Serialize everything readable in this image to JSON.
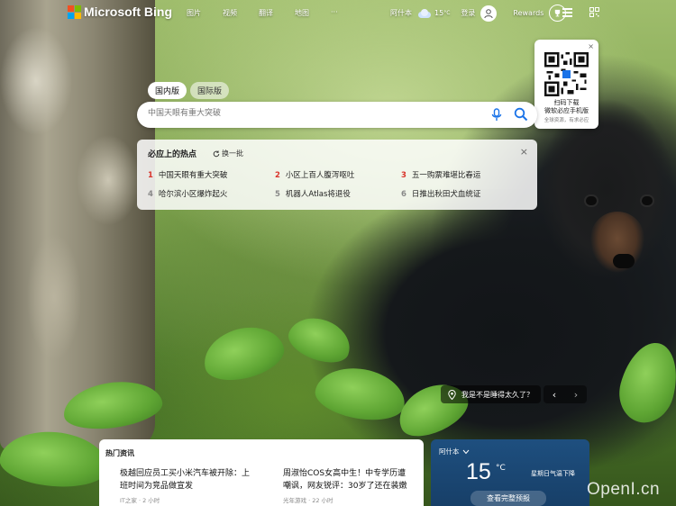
{
  "brand": {
    "name": "Microsoft Bing"
  },
  "nav": {
    "items": [
      "图片",
      "视频",
      "翻译",
      "地图",
      "···"
    ]
  },
  "topright": {
    "city": "阿什本",
    "temp": "15",
    "temp_unit": "°C",
    "login": "登录",
    "rewards": "Rewards"
  },
  "qr_popup": {
    "close": "×",
    "line1": "扫码下载",
    "line2": "微软必应手机版",
    "line3": "全球资源，有求必应"
  },
  "search": {
    "tabs": [
      "国内版",
      "国际版"
    ],
    "placeholder": "中国天眼有重大突破"
  },
  "hot": {
    "title": "必应上的热点",
    "refresh": "换一批",
    "close": "×",
    "items": [
      {
        "num": "1",
        "text": "中国天眼有重大突破"
      },
      {
        "num": "2",
        "text": "小区上百人腹泻呕吐"
      },
      {
        "num": "3",
        "text": "五一购票难堪比春运"
      },
      {
        "num": "4",
        "text": "哈尔滨小区爆炸起火"
      },
      {
        "num": "5",
        "text": "机器人Atlas将退役"
      },
      {
        "num": "6",
        "text": "日推出秋田犬血统证"
      }
    ]
  },
  "image_caption": {
    "text": "我是不是睡得太久了？",
    "prev": "‹",
    "next": "›"
  },
  "news": {
    "title": "热门资讯",
    "items": [
      {
        "title": "极越回应员工买小米汽车被开除：上班时间为竞品做宣发",
        "source": "IT之家 · 2 小时"
      },
      {
        "title": "周淑怡COS女高中生！中专学历遭嘲讽，网友锐评：30岁了还在装嫩",
        "source": "光年游戏 · 22 小时"
      }
    ]
  },
  "weather": {
    "city": "阿什本",
    "temp": "15",
    "unit": "°C",
    "desc": "星期日气温下降",
    "button": "查看完整预报"
  },
  "watermark": "OpenI.cn",
  "colors": {
    "accent": "#1a73e8",
    "hot_top": "#d9342b",
    "weather_bg": "#1e4f7f"
  }
}
